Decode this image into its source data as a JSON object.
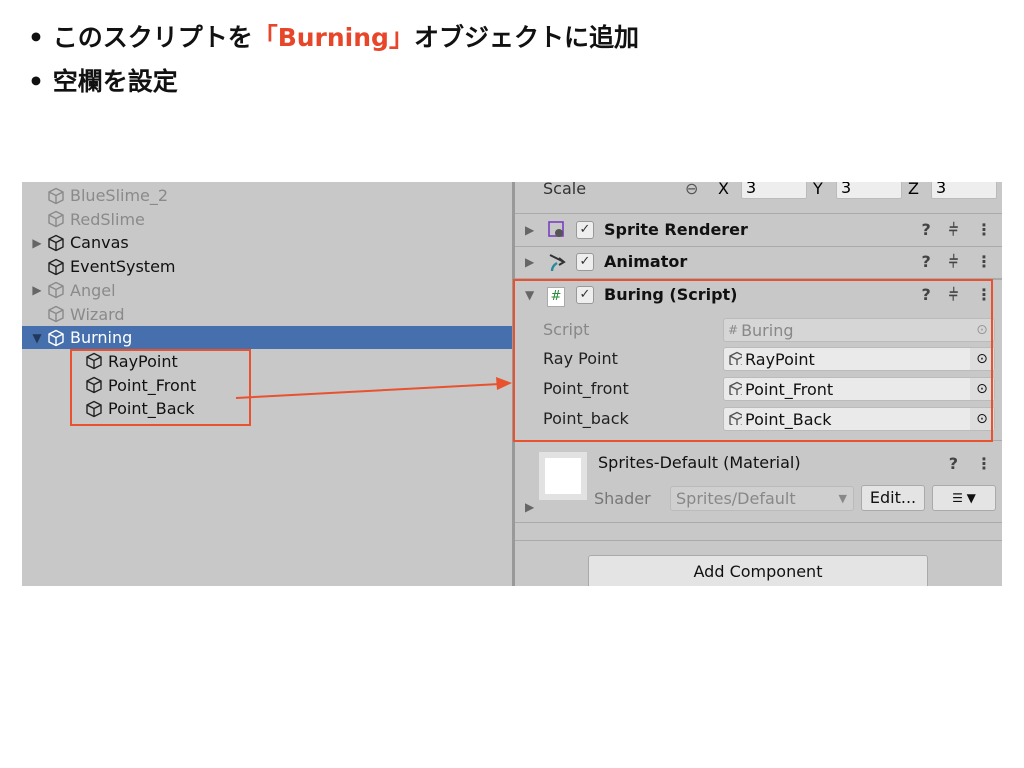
{
  "slide": {
    "bullets": [
      {
        "prefix": "このスクリプトを",
        "highlight": "「Burning」",
        "suffix": "オブジェクトに追加"
      },
      {
        "prefix": "空欄を設定"
      }
    ],
    "accent": "#e8462a"
  },
  "hierarchy": {
    "items": [
      {
        "label": "BlueSlime_2",
        "dim": true
      },
      {
        "label": "RedSlime",
        "dim": true
      },
      {
        "label": "Canvas",
        "expand": "collapsed"
      },
      {
        "label": "EventSystem"
      },
      {
        "label": "Angel",
        "dim": true,
        "expand": "collapsed"
      },
      {
        "label": "Wizard",
        "dim": true
      },
      {
        "label": "Burning",
        "selected": true,
        "expand": "expanded"
      },
      {
        "label": "RayPoint",
        "child": true
      },
      {
        "label": "Point_Front",
        "child": true
      },
      {
        "label": "Point_Back",
        "child": true
      }
    ],
    "selected_color": "#4570ad"
  },
  "inspector": {
    "scale": {
      "label": "Scale",
      "x_label": "X",
      "x": "3",
      "y_label": "Y",
      "y": "3",
      "z_label": "Z",
      "z": "3"
    },
    "components": [
      {
        "title": "Sprite Renderer"
      },
      {
        "title": "Animator"
      },
      {
        "title": "Buring (Script)"
      }
    ],
    "script_fields": [
      {
        "label": "Script",
        "value": "Buring"
      },
      {
        "label": "Ray Point",
        "value": "RayPoint"
      },
      {
        "label": "Point_front",
        "value": "Point_Front"
      },
      {
        "label": "Point_back",
        "value": "Point_Back"
      }
    ],
    "material": {
      "title": "Sprites-Default (Material)",
      "shader_label": "Shader",
      "shader": "Sprites/Default",
      "edit": "Edit..."
    },
    "add_component": "Add Component"
  }
}
